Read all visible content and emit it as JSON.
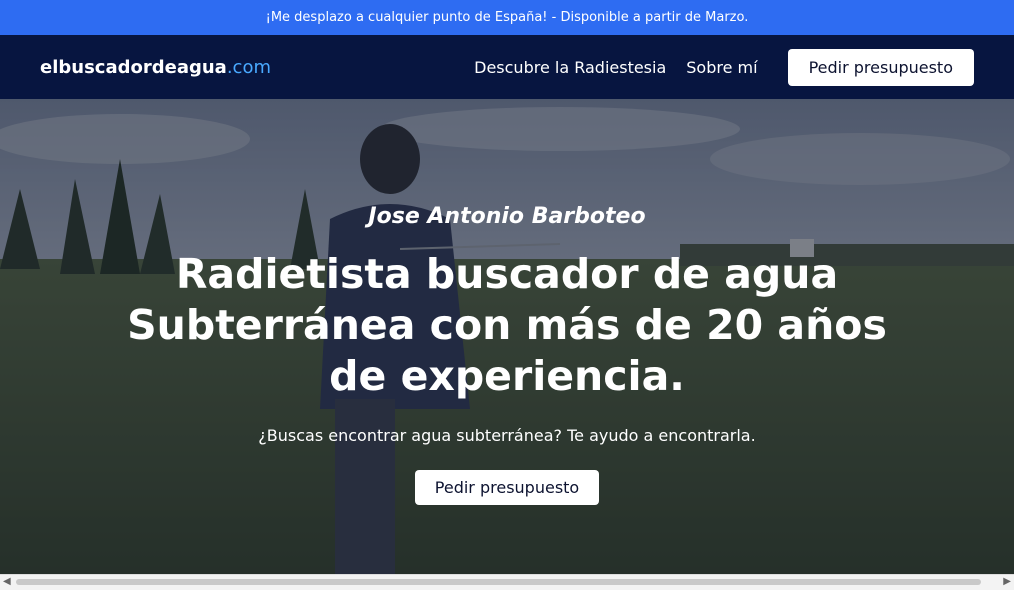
{
  "announcement": "¡Me desplazo a cualquier punto de España! - Disponible a partir de Marzo.",
  "brand": {
    "name": "elbuscadordeagua",
    "tld": ".com"
  },
  "nav": {
    "links": [
      "Descubre la Radiestesia",
      "Sobre mí"
    ],
    "cta": "Pedir presupuesto"
  },
  "hero": {
    "name": "Jose Antonio Barboteo",
    "headline": "Radietista buscador de agua Subterránea con más de 20 años de experiencia.",
    "subtitle": "¿Buscas encontrar agua subterránea? Te ayudo a encontrarla.",
    "cta": "Pedir presupuesto"
  },
  "colors": {
    "announcement_bg": "#2e6cf2",
    "nav_bg": "#071540",
    "brand_accent": "#49a9ff"
  }
}
